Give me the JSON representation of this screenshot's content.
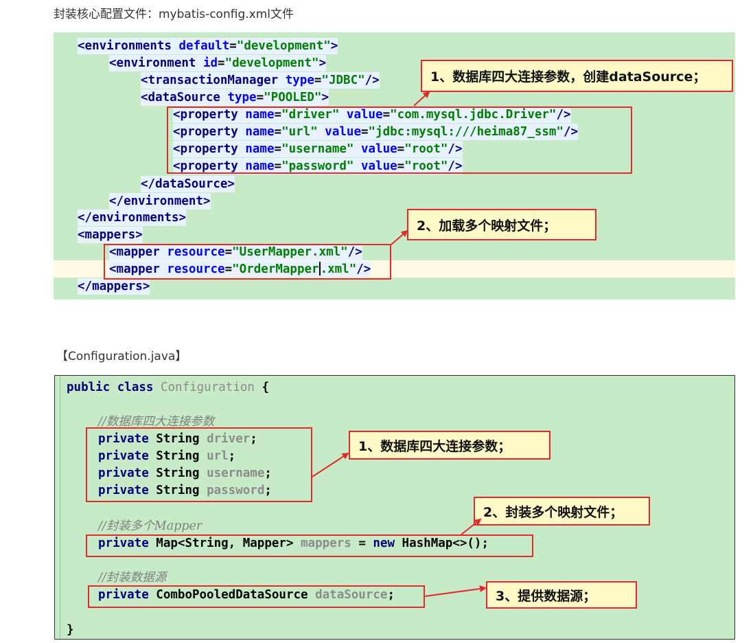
{
  "caption_xml": "封装核心配置文件：mybatis-config.xml文件",
  "caption_java": "【Configuration.java】",
  "xml_code": {
    "environments_open": {
      "tag": "<environments ",
      "attr": "default",
      "eq": "=",
      "val": "\"development\"",
      "close": ">"
    },
    "environment_open": {
      "tag": "<environment ",
      "attr": "id",
      "eq": "=",
      "val": "\"development\"",
      "close": ">"
    },
    "transaction_manager": {
      "tag": "<transactionManager ",
      "attr": "type",
      "eq": "=",
      "val": "\"JDBC\"",
      "close": "/>"
    },
    "datasource_open": {
      "tag": "<dataSource ",
      "attr": "type",
      "eq": "=",
      "val": "\"POOLED\"",
      "close": ">"
    },
    "properties": [
      {
        "tag": "<property ",
        "a1": "name",
        "v1": "\"driver\"",
        "a2": "value",
        "v2": "\"com.mysql.jdbc.Driver\"",
        "close": "/>"
      },
      {
        "tag": "<property ",
        "a1": "name",
        "v1": "\"url\"",
        "a2": "value",
        "v2": "\"jdbc:mysql:///heima87_ssm\"",
        "close": "/>"
      },
      {
        "tag": "<property ",
        "a1": "name",
        "v1": "\"username\"",
        "a2": "value",
        "v2": "\"root\"",
        "close": "/>"
      },
      {
        "tag": "<property ",
        "a1": "name",
        "v1": "\"password\"",
        "a2": "value",
        "v2": "\"root\"",
        "close": "/>"
      }
    ],
    "datasource_close": "</dataSource>",
    "environment_close": "</environment>",
    "environments_close": "</environments>",
    "mappers_open": "<mappers>",
    "mappers": [
      {
        "tag": "<mapper ",
        "attr": "resource",
        "eq": "=",
        "val_a": "\"UserMapper.xml\"",
        "val_b": "",
        "close": "/>"
      },
      {
        "tag": "<mapper ",
        "attr": "resource",
        "eq": "=",
        "val_a": "\"OrderMapper",
        "val_b": ".xml\"",
        "close": "/>"
      }
    ],
    "mappers_close": "</mappers>"
  },
  "xml_callouts": [
    "1、数据库四大连接参数，创建dataSource；",
    "2、加载多个映射文件；"
  ],
  "java_code": {
    "class_kw": "public class ",
    "class_name": "Configuration",
    "class_open": " {",
    "comment_db": "//数据库四大连接参数",
    "fields": [
      {
        "kw": "private ",
        "type": "String ",
        "name": "driver",
        "end": ";"
      },
      {
        "kw": "private ",
        "type": "String ",
        "name": "url",
        "end": ";"
      },
      {
        "kw": "private ",
        "type": "String ",
        "name": "username",
        "end": ";"
      },
      {
        "kw": "private ",
        "type": "String ",
        "name": "password",
        "end": ";"
      }
    ],
    "comment_mapper": "//封装多个Mapper",
    "mapper_field": {
      "kw": "private ",
      "type": "Map<String, Mapper> ",
      "name": "mappers",
      "eq": " = ",
      "new_kw": "new ",
      "init": "HashMap<>();"
    },
    "comment_ds": "//封装数据源",
    "ds_field": {
      "kw": "private ",
      "type": "ComboPooledDataSource ",
      "name": "dataSource",
      "end": ";"
    },
    "class_close": "}"
  },
  "java_callouts": [
    "1、数据库四大连接参数；",
    "2、封装多个映射文件；",
    "3、提供数据源；"
  ],
  "colors": {
    "code_bg": "#c7ebc7",
    "callout_bg": "#fff8c7",
    "callout_border": "#e8272b",
    "xml_tag": "#000080",
    "xml_attr": "#0000ff",
    "xml_value": "#008000",
    "java_field": "#8b8b8b",
    "java_comment": "#808080"
  }
}
